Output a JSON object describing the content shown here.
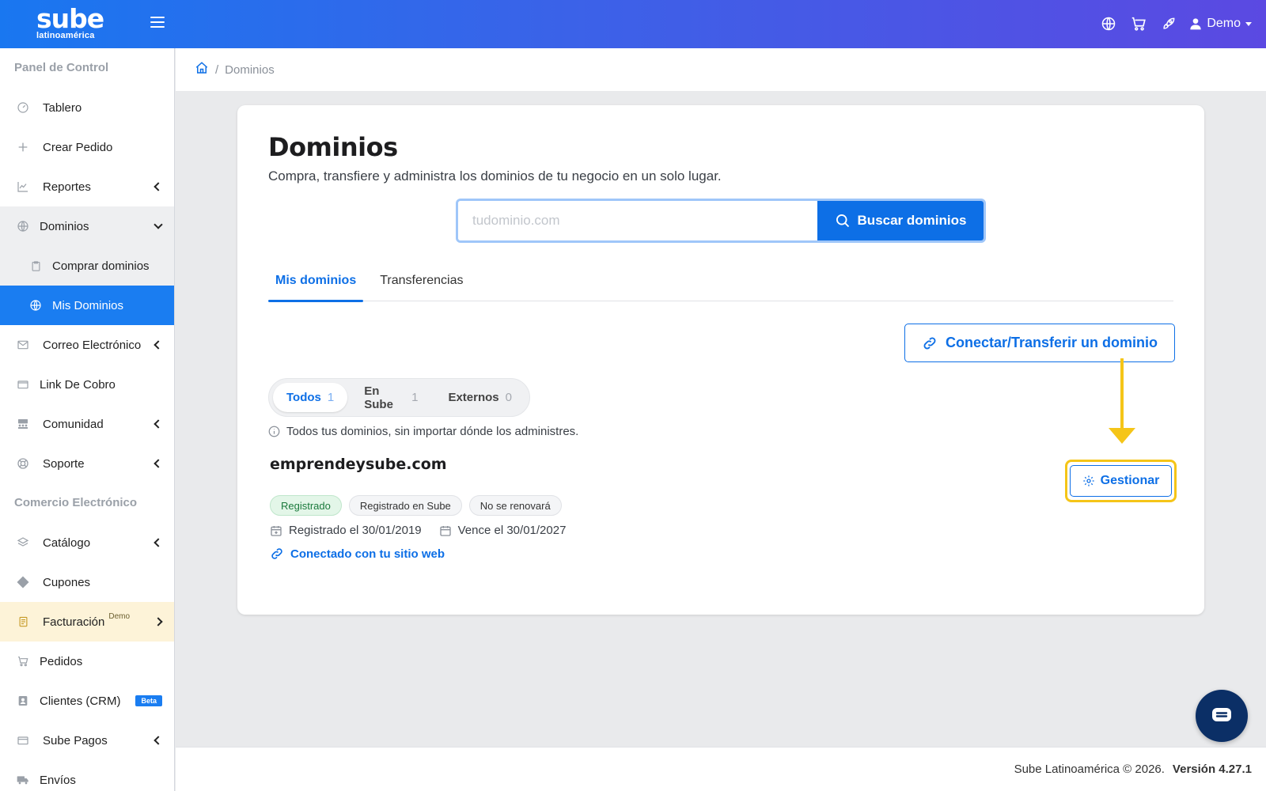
{
  "brand": {
    "name": "sube",
    "sub": "latinoamérica"
  },
  "header": {
    "user_name": "Demo"
  },
  "sidebar": {
    "section1": "Panel de Control",
    "section2": "Comercio Electrónico",
    "items": {
      "tablero": "Tablero",
      "crear_pedido": "Crear Pedido",
      "reportes": "Reportes",
      "dominios": "Dominios",
      "comprar_dominios": "Comprar dominios",
      "mis_dominios": "Mis Dominios",
      "correo": "Correo Electrónico",
      "link_cobro": "Link De Cobro",
      "comunidad": "Comunidad",
      "soporte": "Soporte",
      "catalogo": "Catálogo",
      "cupones": "Cupones",
      "facturacion": "Facturación",
      "facturacion_badge": "Demo",
      "pedidos": "Pedidos",
      "clientes": "Clientes (CRM)",
      "clientes_badge": "Beta",
      "sube_pagos": "Sube Pagos",
      "envios": "Envíos"
    }
  },
  "breadcrumb": {
    "separator": "/",
    "current": "Dominios"
  },
  "main": {
    "title": "Dominios",
    "subtitle": "Compra, transfiere y administra los dominios de tu negocio en un solo lugar.",
    "search": {
      "placeholder": "tudominio.com",
      "value": "",
      "button": "Buscar dominios"
    },
    "tabs": [
      "Mis dominios",
      "Transferencias"
    ],
    "connect_button": "Conectar/Transferir un dominio",
    "filters": [
      {
        "label": "Todos",
        "count": "1"
      },
      {
        "label": "En Sube",
        "count": "1"
      },
      {
        "label": "Externos",
        "count": "0"
      }
    ],
    "filter_info": "Todos tus dominios, sin importar dónde los administres.",
    "domain": {
      "name": "emprendeysube.com",
      "badges": [
        "Registrado",
        "Registrado en Sube",
        "No se renovará"
      ],
      "registered": "Registrado el 30/01/2019",
      "expires": "Vence el 30/01/2027",
      "connected": "Conectado con tu sitio web",
      "manage_button": "Gestionar"
    }
  },
  "footer": {
    "copyright": "Sube Latinoamérica © 2026.",
    "version": "Versión 4.27.1"
  },
  "colors": {
    "primary": "#0d6fe6",
    "highlight": "#f5c518",
    "active_nav": "#1a7df1"
  }
}
